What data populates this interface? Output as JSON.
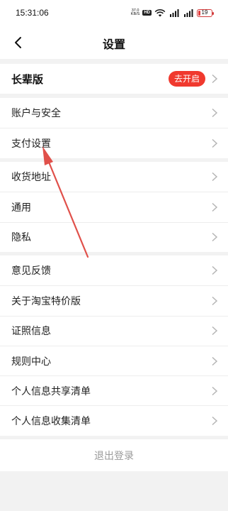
{
  "status_bar": {
    "time": "15:31:06",
    "net_speed_value": "37.0",
    "net_speed_unit": "KB/S",
    "hd_badge": "HD",
    "battery_level": "19"
  },
  "header": {
    "title": "设置"
  },
  "groups": [
    {
      "items": [
        {
          "label": "长辈版",
          "badge": "去开启"
        }
      ]
    },
    {
      "items": [
        {
          "label": "账户与安全"
        },
        {
          "label": "支付设置"
        }
      ]
    },
    {
      "items": [
        {
          "label": "收货地址"
        },
        {
          "label": "通用"
        },
        {
          "label": "隐私"
        }
      ]
    },
    {
      "items": [
        {
          "label": "意见反馈"
        },
        {
          "label": "关于淘宝特价版"
        },
        {
          "label": "证照信息"
        },
        {
          "label": "规则中心"
        },
        {
          "label": "个人信息共享清单"
        },
        {
          "label": "个人信息收集清单"
        }
      ]
    }
  ],
  "logout_label": "退出登录",
  "colors": {
    "accent": "#f0392e",
    "annotation_arrow": "#e0504a",
    "page_bg": "#f2f2f2"
  },
  "icons": {
    "back": "chevron-left-icon",
    "row_arrow": "chevron-right-icon"
  }
}
